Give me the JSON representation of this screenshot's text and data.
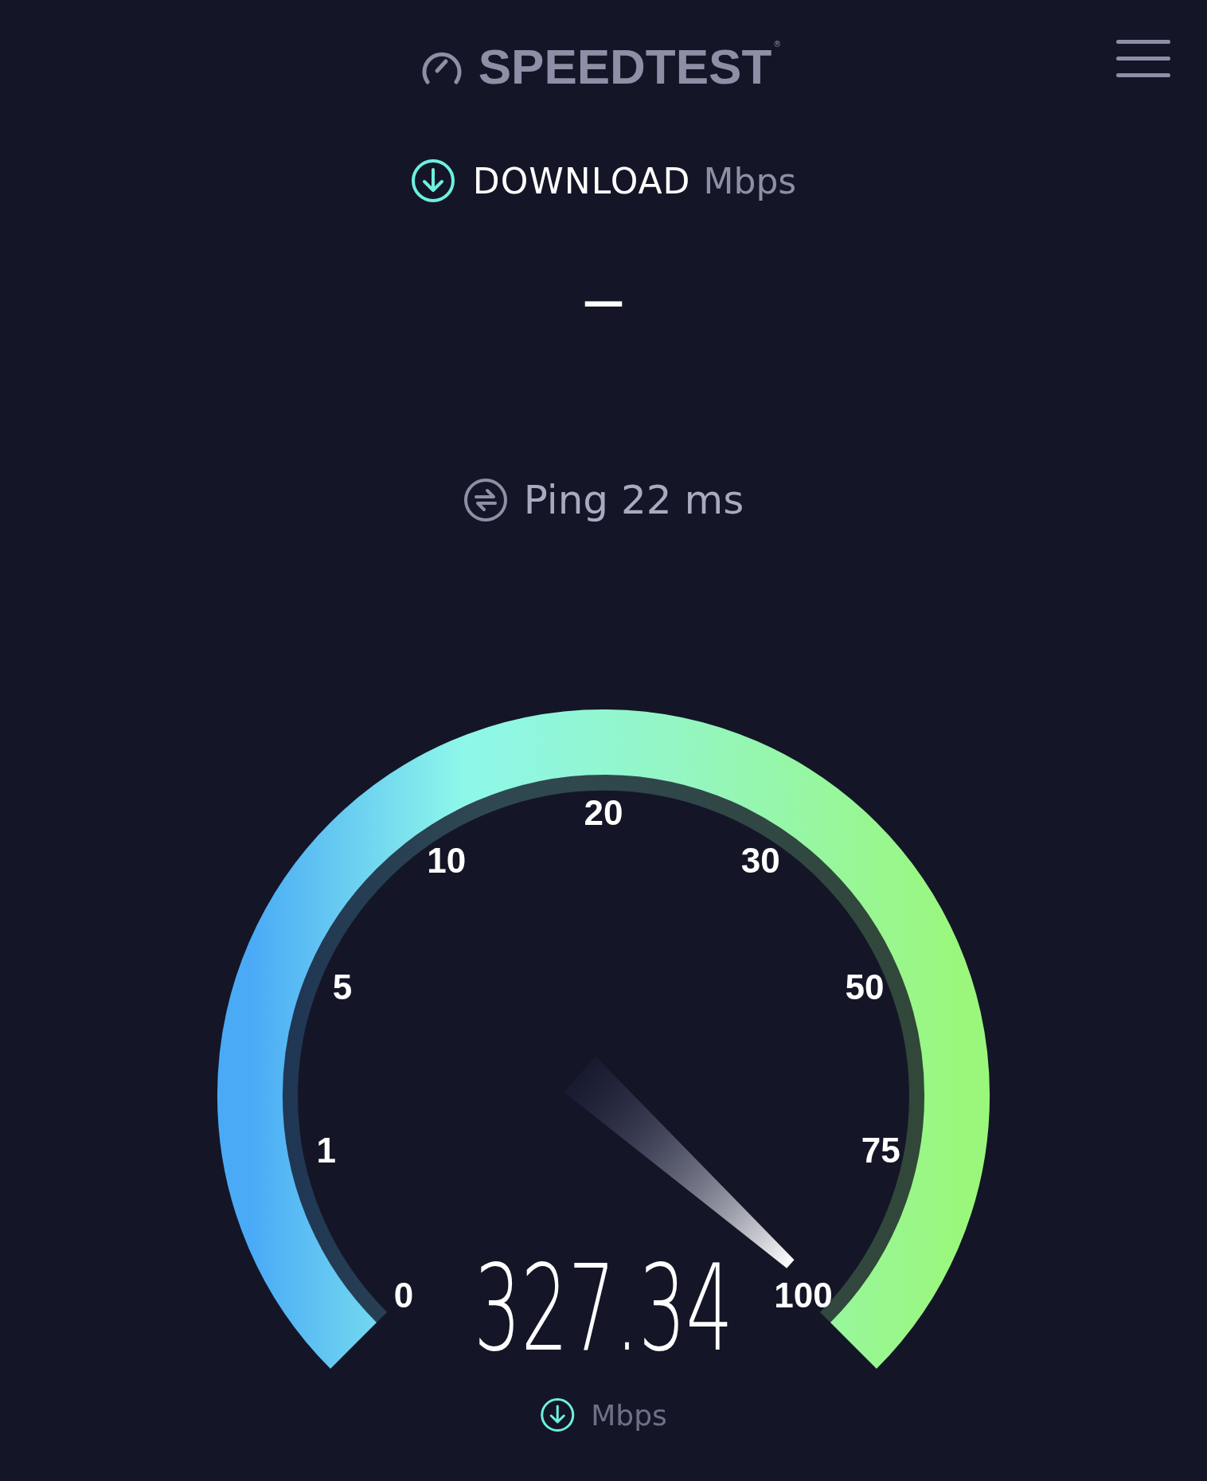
{
  "header": {
    "logo": "SPEEDTEST",
    "registered_mark": "®"
  },
  "download": {
    "label": "DOWNLOAD",
    "unit": "Mbps",
    "result": "—"
  },
  "ping": {
    "text": "Ping 22 ms"
  },
  "gauge": {
    "ticks": [
      "0",
      "1",
      "5",
      "10",
      "20",
      "30",
      "50",
      "75",
      "100"
    ],
    "reading": "327.34",
    "unit": "Mbps"
  }
}
